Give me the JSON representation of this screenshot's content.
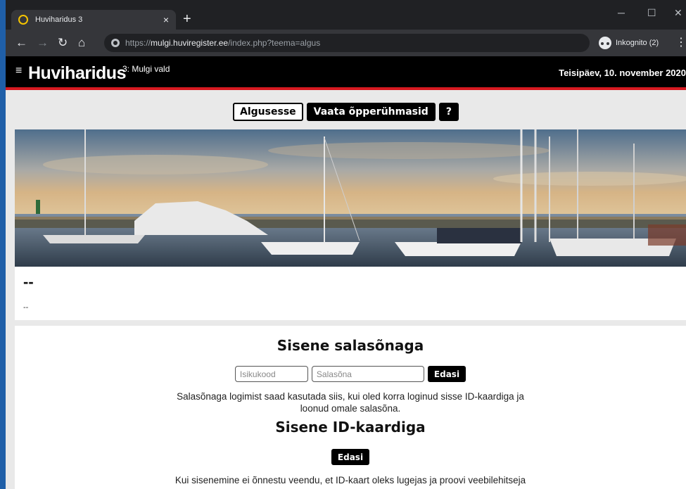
{
  "browser": {
    "tab_title": "Huviharidus 3",
    "tab_close": "×",
    "new_tab": "+",
    "url_scheme": "https://",
    "url_host": "mulgi.huviregister.ee",
    "url_path": "/index.php?teema=algus",
    "incognito_label": "Inkognito (2)",
    "icons": [
      "back-icon",
      "forward-icon",
      "reload-icon",
      "home-icon",
      "site-info-icon",
      "incognito-icon",
      "menu-icon"
    ]
  },
  "header": {
    "menu_glyph": "≡",
    "brand": "Huviharidus",
    "subtitle": "3: Mulgi vald",
    "date": "Teisipäev, 10. november 2020",
    "accent_color": "#d71920"
  },
  "nav": {
    "home": "Algusesse",
    "groups": "Vaata õpperühmasid",
    "help": "?"
  },
  "banner_card": {
    "title": "--",
    "subtitle": "--"
  },
  "login": {
    "password_heading": "Sisene salasõnaga",
    "id_placeholder": "Isikukood",
    "password_placeholder": "Salasõna",
    "submit_label": "Edasi",
    "password_note_line1": "Salasõnaga logimist saad kasutada siis, kui oled korra loginud sisse ID-kaardiga ja",
    "password_note_line2": "loonud omale salasõna.",
    "idcard_heading": "Sisene ID-kaardiga",
    "idcard_submit_label": "Edasi",
    "idcard_note": "Kui sisenemine ei õnnestu veendu, et ID-kaart oleks lugejas ja proovi veebilehitseja"
  }
}
